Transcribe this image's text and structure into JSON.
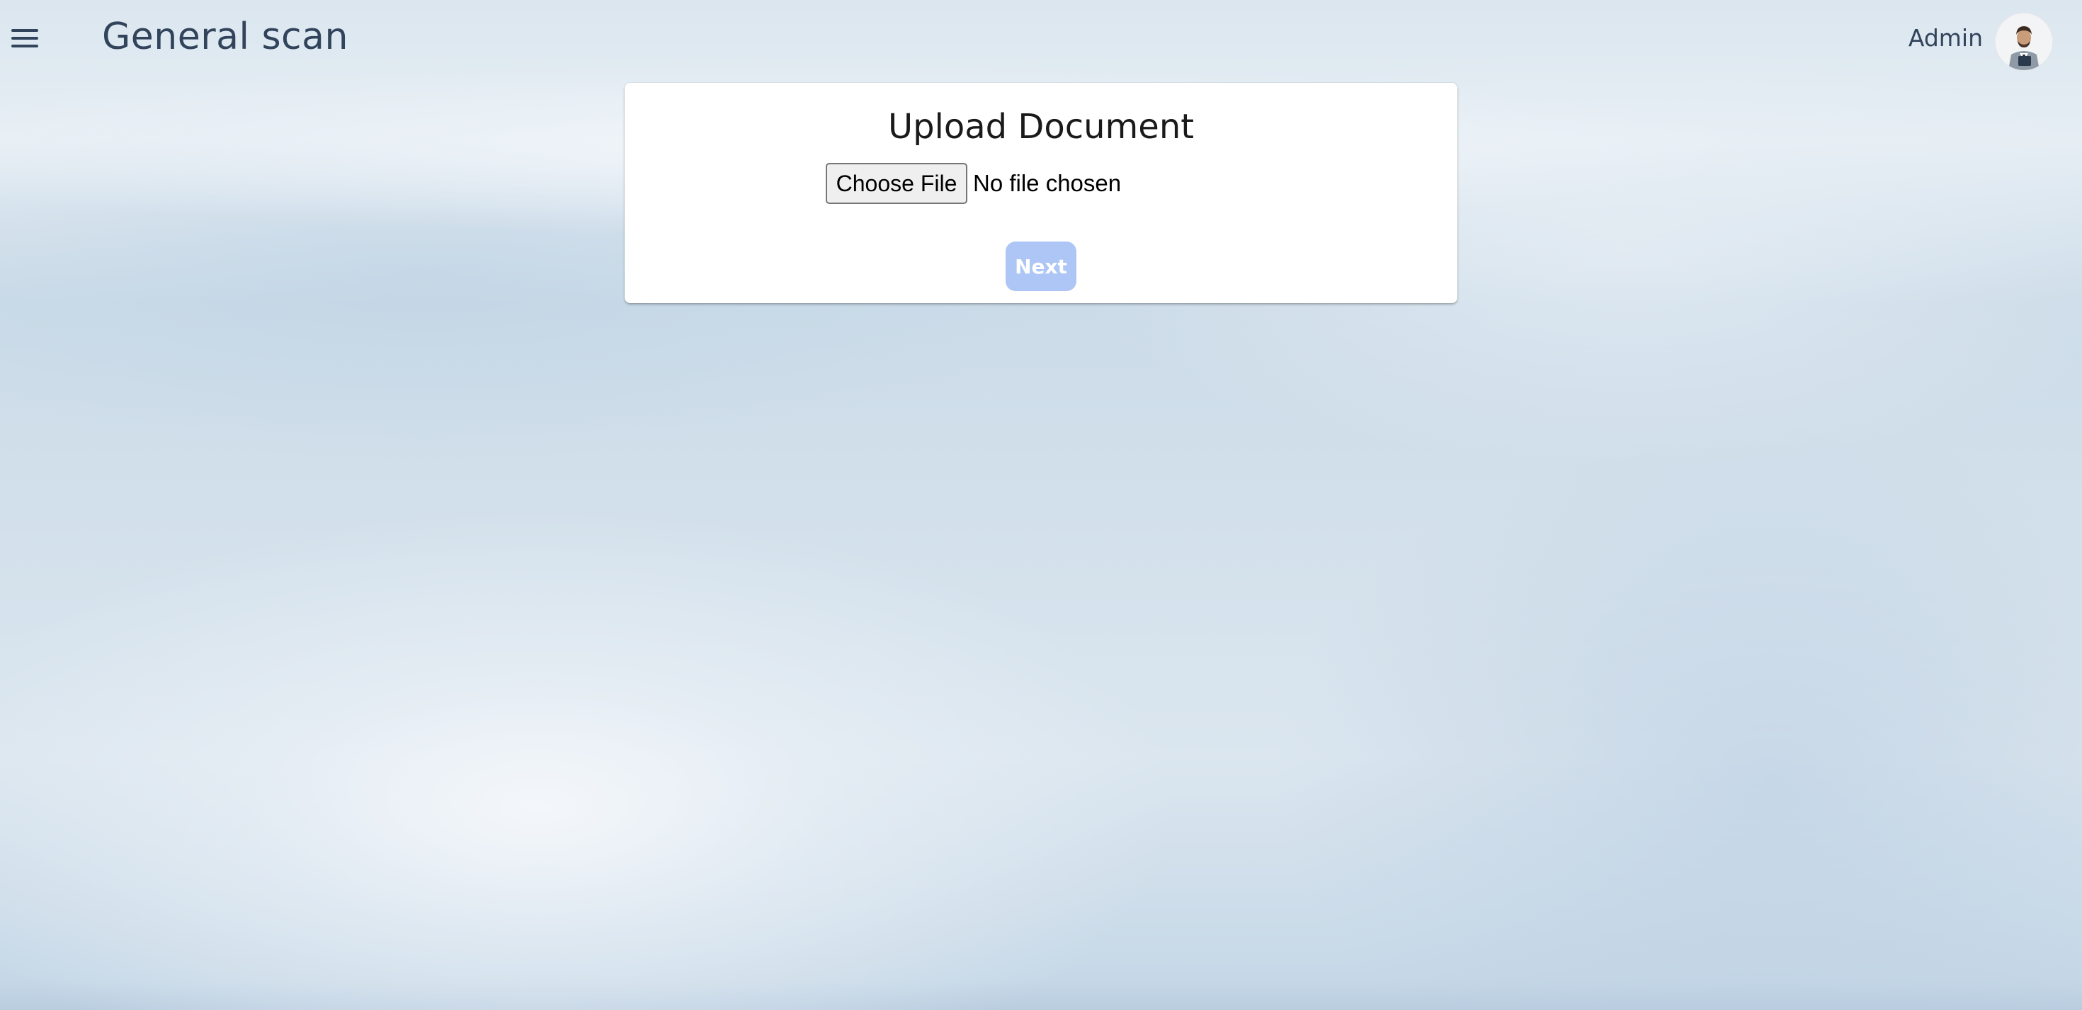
{
  "header": {
    "menu_icon": "hamburger-menu-icon",
    "title": "General scan",
    "user_name": "Admin",
    "avatar_icon": "user-avatar"
  },
  "upload_card": {
    "title": "Upload Document",
    "choose_file_label": "Choose File",
    "file_status": "No file chosen",
    "next_label": "Next",
    "next_enabled": false
  },
  "colors": {
    "title_text": "#32445c",
    "next_button_disabled": "#aec6f5",
    "card_background": "#ffffff"
  }
}
